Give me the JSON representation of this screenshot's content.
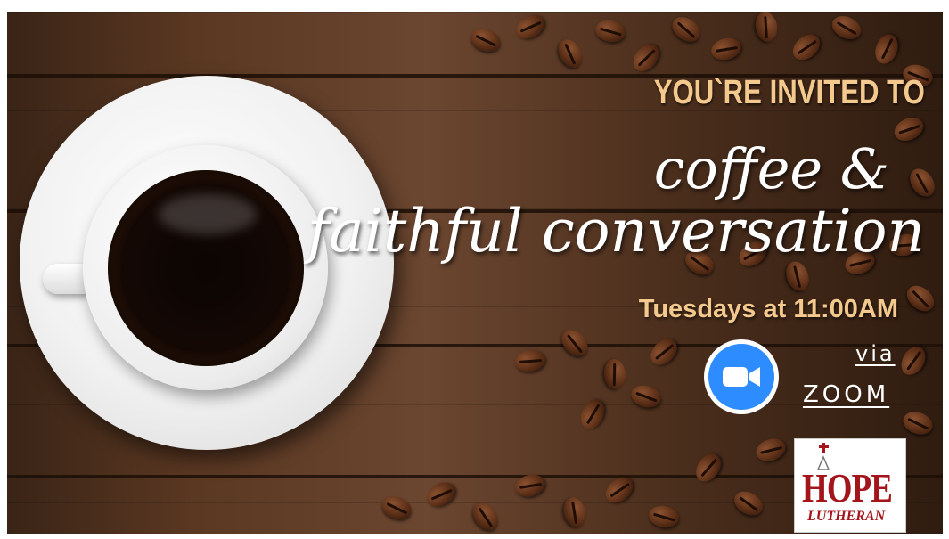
{
  "invitation": {
    "line1": "YOU`RE INVITED TO",
    "title_line1": "coffee &",
    "title_line2": "faithful conversation",
    "schedule": "Tuesdays at 11:00AM",
    "via": "via",
    "platform": "ZOOM"
  },
  "logo": {
    "name": "HOPE",
    "subtitle": "LUTHERAN"
  },
  "icons": {
    "zoom": "zoom-video-camera-icon",
    "logo_cross": "cross-icon"
  },
  "colors": {
    "accent_text": "#f3c98e",
    "script_text": "#ffffff",
    "zoom_blue": "#2d8cff",
    "logo_red": "#a3151b",
    "wood_dark": "#2f1c10"
  }
}
